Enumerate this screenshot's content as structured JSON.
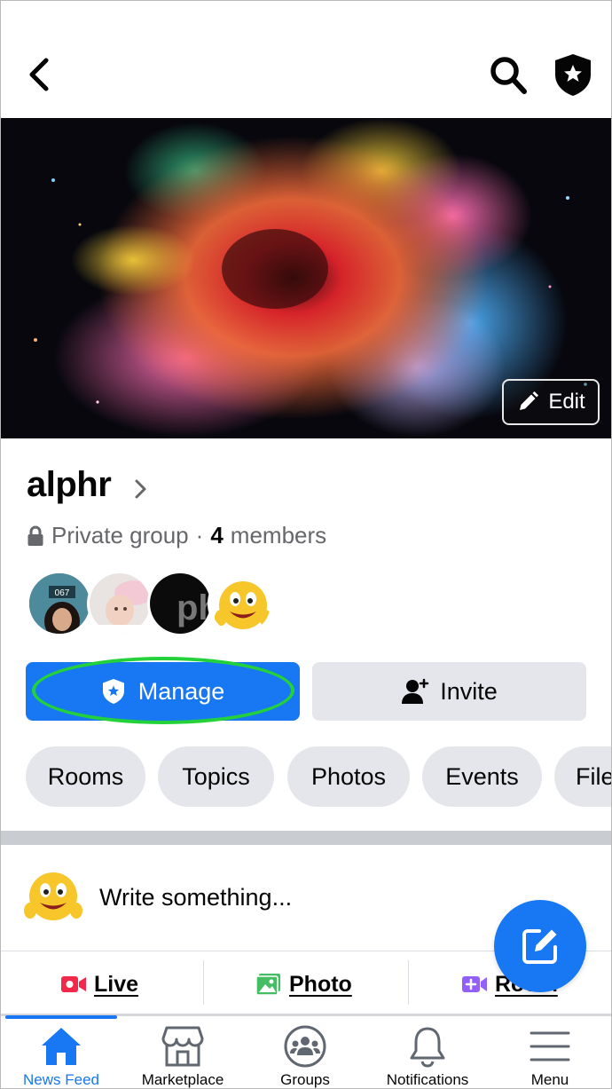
{
  "header": {
    "back_icon": "chevron-left-icon",
    "search_icon": "search-icon",
    "admin_icon": "admin-shield-star-icon"
  },
  "cover": {
    "edit_label": "Edit",
    "edit_icon": "pencil-icon"
  },
  "group": {
    "name": "alphr",
    "privacy": "Private group",
    "separator": "·",
    "member_count": "4",
    "members_label": "members",
    "member_avatars": [
      "member-avatar-067",
      "member-avatar-baby",
      "member-avatar-ph-logo",
      "member-avatar-emoji"
    ]
  },
  "actions": {
    "manage_label": "Manage",
    "invite_label": "Invite",
    "highlight_color": "#23d23a",
    "accent_color": "#1877f2"
  },
  "chips": [
    "Rooms",
    "Topics",
    "Photos",
    "Events",
    "Files"
  ],
  "composer": {
    "placeholder": "Write something...",
    "live_label": "Live",
    "photo_label": "Photo",
    "room_label": "Room"
  },
  "bottom_nav": [
    {
      "label": "News Feed",
      "icon": "home-icon",
      "active": true
    },
    {
      "label": "Marketplace",
      "icon": "store-icon",
      "active": false
    },
    {
      "label": "Groups",
      "icon": "groups-icon",
      "active": false
    },
    {
      "label": "Notifications",
      "icon": "bell-icon",
      "active": false
    },
    {
      "label": "Menu",
      "icon": "hamburger-icon",
      "active": false
    }
  ]
}
